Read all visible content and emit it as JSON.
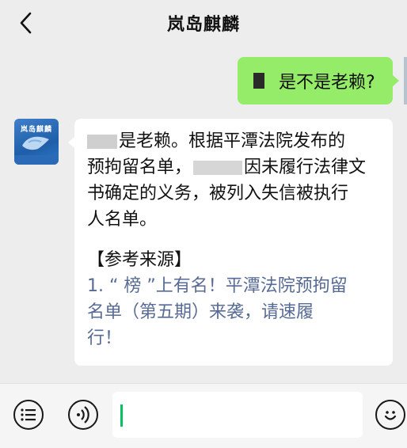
{
  "header": {
    "title": "岚岛麒麟",
    "back_icon": "chevron-left-icon"
  },
  "messages": {
    "outgoing": {
      "text": "是不是老赖?"
    },
    "incoming": {
      "avatar_text": "岚岛麒麟",
      "line1": "是老赖。根据平潭法院发布的",
      "line2a": "预拘留名单，",
      "line2b": "因未履行法律文",
      "line3": "书确定的义务，被列入失信被执行",
      "line4": "人名单。",
      "ref_title": "【参考来源】",
      "ref_link_1": "1. “ 榜 ”上有名！平潭法院预拘留",
      "ref_link_2": "名单（第五期）来袭，请速履",
      "ref_link_3": "行！"
    }
  },
  "footer": {
    "menu_icon": "list-menu-icon",
    "voice_icon": "voice-icon",
    "emoji_icon": "emoji-icon",
    "input_value": ""
  },
  "colors": {
    "bubble_out": "#95ec69",
    "link": "#576b95",
    "caret": "#07c160"
  }
}
